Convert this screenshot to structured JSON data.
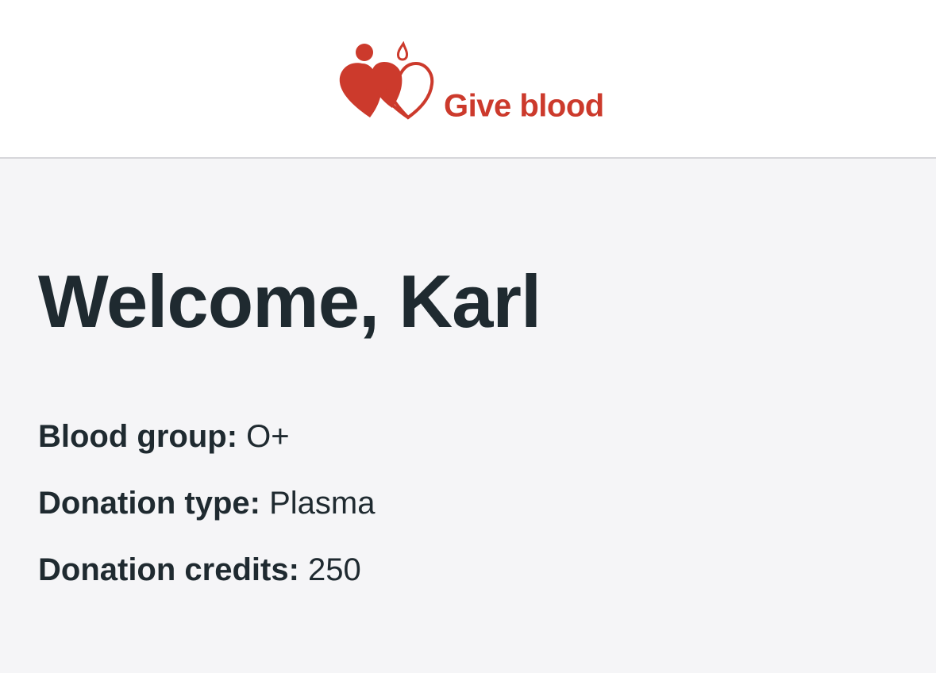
{
  "header": {
    "logo_text": "Give blood",
    "logo_icon": "hearts-drop-icon"
  },
  "main": {
    "greeting": "Welcome, Karl",
    "fields": [
      {
        "label": "Blood group:",
        "value": "O+"
      },
      {
        "label": "Donation type:",
        "value": "Plasma"
      },
      {
        "label": "Donation credits:",
        "value": "250"
      }
    ]
  },
  "colors": {
    "brand": "#cc3a2c",
    "text": "#1f2a30",
    "background": "#f5f5f7",
    "header_bg": "#ffffff"
  }
}
